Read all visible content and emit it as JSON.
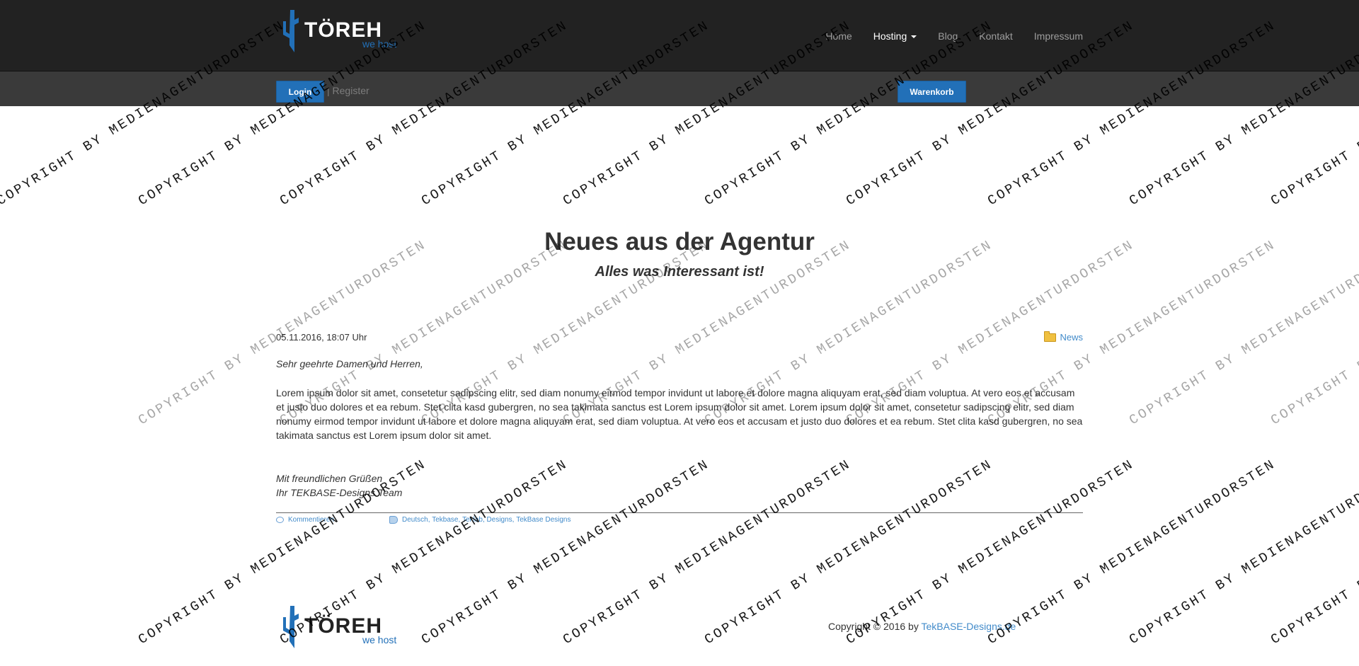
{
  "brand": {
    "name": "TÖREH",
    "tagline": "we host",
    "accent_color": "#2270b8"
  },
  "nav": {
    "items": [
      {
        "label": "Home",
        "active": false
      },
      {
        "label": "Hosting",
        "active": true,
        "has_dropdown": true
      },
      {
        "label": "Blog",
        "active": false
      },
      {
        "label": "Kontakt",
        "active": false
      },
      {
        "label": "Impressum",
        "active": false
      }
    ]
  },
  "subbar": {
    "login_label": "Login",
    "register_label": "| Register",
    "cart_label": "Warenkorb"
  },
  "main": {
    "title": "Neues aus der Agentur",
    "subtitle": "Alles was Interessant ist!"
  },
  "post": {
    "date": "05.11.2016, 18:07 Uhr",
    "category": "News",
    "greeting": "Sehr geehrte Damen und Herren,",
    "body": "Lorem ipsum dolor sit amet, consetetur sadipscing elitr, sed diam nonumy eirmod tempor invidunt ut labore et dolore magna aliquyam erat, sed diam voluptua. At vero eos et accusam et justo duo dolores et ea rebum. Stet clita kasd gubergren, no sea takimata sanctus est Lorem ipsum dolor sit amet. Lorem ipsum dolor sit amet, consetetur sadipscing elitr, sed diam nonumy eirmod tempor invidunt ut labore et dolore magna aliquyam erat, sed diam voluptua. At vero eos et accusam et justo duo dolores et ea rebum. Stet clita kasd gubergren, no sea takimata sanctus est Lorem ipsum dolor sit amet.",
    "closing_line1": "Mit freundlichen Grüßen",
    "closing_line2": "Ihr TEKBASE-Designs Team",
    "comment_label": "Kommentieren",
    "tags": [
      "Deutsch",
      "Tekbase",
      "Teklab",
      "Designs",
      "TekBase Designs"
    ]
  },
  "footer": {
    "copyright_prefix": "Copyright © 2016 by",
    "copyright_link": "TekBASE-Designs.de"
  },
  "watermark": {
    "primary": "COPYRIGHT BY MEDIENAGENTURDORSTEN",
    "secondary": "MEDIENAGENTURDORSTEN"
  }
}
